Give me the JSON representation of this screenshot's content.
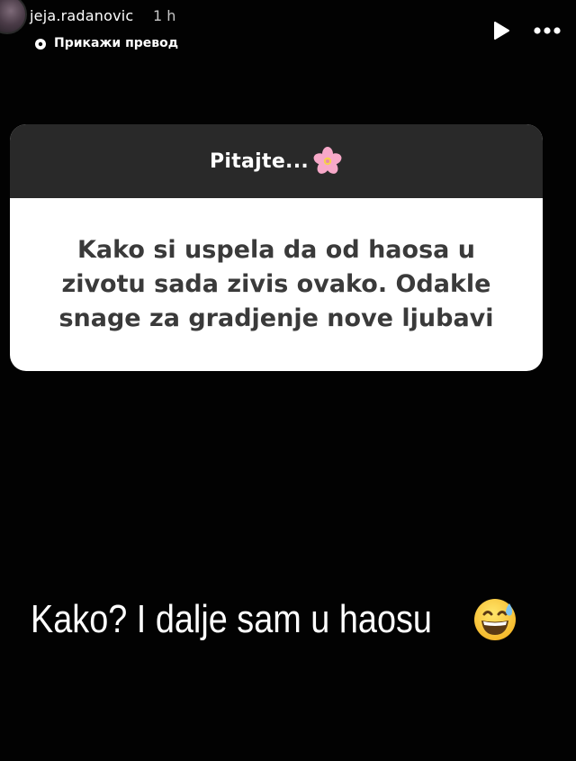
{
  "header": {
    "username": "jeja.radanovic",
    "time_ago": "1 h",
    "translate_label": "Прикажи превод",
    "play_icon": "play-icon",
    "more_icon": "more-horizontal-icon"
  },
  "question_sticker": {
    "title": "Pitajte...",
    "title_emoji": "cherry-blossom-icon",
    "question": "Kako si uspela da od haosa u zivotu sada zivis ovako. Odakle snage za gradjenje nove ljubavi"
  },
  "answer": {
    "text": "Kako? I dalje sam u haosu",
    "emoji": "grinning-sweat-icon"
  },
  "colors": {
    "background": "#020202",
    "sticker_header": "#292929",
    "sticker_body": "#ffffff",
    "question_text": "#3a3a3a"
  }
}
